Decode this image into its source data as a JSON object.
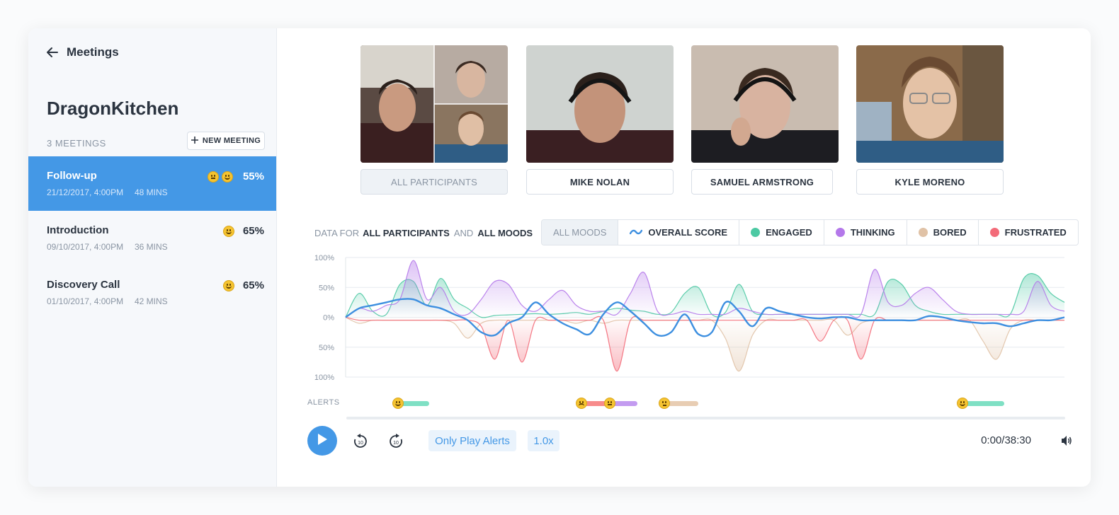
{
  "sidebar": {
    "back_label": "Meetings",
    "project_title": "DragonKitchen",
    "meetings_count": "3 MEETINGS",
    "new_meeting_label": "NEW MEETING",
    "meetings": [
      {
        "title": "Follow-up",
        "date": "21/12/2017, 4:00PM",
        "duration": "48 MINS",
        "score": "55%",
        "emojis": [
          "thinking-face-emoji",
          "smiley-face-emoji"
        ]
      },
      {
        "title": "Introduction",
        "date": "09/10/2017, 4:00PM",
        "duration": "36 MINS",
        "score": "65%",
        "emojis": [
          "smiley-face-emoji"
        ]
      },
      {
        "title": "Discovery Call",
        "date": "01/10/2017, 4:00PM",
        "duration": "42 MINS",
        "score": "65%",
        "emojis": [
          "smiley-face-emoji"
        ]
      }
    ]
  },
  "participants": [
    {
      "name": "ALL PARTICIPANTS",
      "selected": true
    },
    {
      "name": "MIKE NOLAN"
    },
    {
      "name": "SAMUEL ARMSTRONG"
    },
    {
      "name": "KYLE MORENO"
    }
  ],
  "filter": {
    "prefix": "DATA FOR",
    "participants": "ALL PARTICIPANTS",
    "joiner": "AND",
    "moods": "ALL MOODS"
  },
  "mood_tabs": [
    {
      "label": "ALL MOODS",
      "active": true
    },
    {
      "label": "OVERALL SCORE",
      "icon": "wave-icon",
      "color": "#3d8fe0"
    },
    {
      "label": "ENGAGED",
      "color": "#4cc9a3"
    },
    {
      "label": "THINKING",
      "color": "#b478ea"
    },
    {
      "label": "BORED",
      "color": "#e0c2a6"
    },
    {
      "label": "FRUSTRATED",
      "color": "#f36b79"
    }
  ],
  "chart_data": {
    "type": "area",
    "y_tick_labels": [
      "100%",
      "50%",
      "0%",
      "50%",
      "100%"
    ],
    "ylim": [
      -100,
      100
    ],
    "x_count": 54,
    "grid": true,
    "series": [
      {
        "name": "ENGAGED",
        "color": "#4cc9a3",
        "values": [
          0,
          40,
          10,
          5,
          55,
          60,
          20,
          65,
          30,
          15,
          0,
          3,
          4,
          5,
          6,
          5,
          6,
          8,
          5,
          10,
          15,
          12,
          10,
          5,
          8,
          40,
          50,
          5,
          8,
          55,
          10,
          5,
          5,
          5,
          5,
          5,
          5,
          5,
          5,
          5,
          60,
          55,
          20,
          10,
          5,
          5,
          5,
          5,
          5,
          5,
          65,
          70,
          40,
          25
        ]
      },
      {
        "name": "THINKING",
        "color": "#b478ea",
        "values": [
          0,
          15,
          10,
          20,
          30,
          95,
          30,
          50,
          10,
          5,
          30,
          60,
          55,
          20,
          10,
          30,
          45,
          20,
          10,
          10,
          5,
          40,
          75,
          10,
          5,
          10,
          5,
          5,
          5,
          15,
          10,
          5,
          5,
          5,
          5,
          5,
          5,
          5,
          5,
          80,
          25,
          20,
          40,
          50,
          30,
          10,
          5,
          5,
          5,
          5,
          10,
          60,
          20,
          10
        ]
      },
      {
        "name": "BORED",
        "color": "#e0c2a6",
        "values": [
          0,
          -10,
          -5,
          -5,
          -5,
          -5,
          -5,
          -5,
          -10,
          -35,
          -10,
          -5,
          -5,
          -5,
          -5,
          -5,
          -5,
          -10,
          -5,
          -10,
          -5,
          -5,
          -5,
          -5,
          -5,
          -5,
          -5,
          -5,
          -35,
          -90,
          -30,
          -5,
          -5,
          -5,
          -5,
          -5,
          -5,
          -30,
          -10,
          -5,
          -5,
          -5,
          -5,
          -5,
          -5,
          -5,
          -5,
          -40,
          -70,
          -20,
          -5,
          -5,
          -5,
          -5
        ]
      },
      {
        "name": "FRUSTRATED",
        "color": "#f36b79",
        "values": [
          0,
          -5,
          -5,
          -5,
          -5,
          -5,
          -5,
          -5,
          -5,
          -5,
          -15,
          -70,
          -5,
          -75,
          -5,
          -5,
          -5,
          -5,
          -5,
          -5,
          -90,
          -5,
          -5,
          -5,
          -5,
          -5,
          -5,
          -5,
          -5,
          -5,
          -5,
          -5,
          -5,
          -5,
          -5,
          -40,
          -5,
          -5,
          -70,
          -5,
          -5,
          -5,
          -5,
          -5,
          -5,
          -5,
          -5,
          -5,
          -5,
          -5,
          -5,
          -5,
          -5,
          -5
        ]
      },
      {
        "name": "OVERALL SCORE",
        "color": "#3d8fe0",
        "values": [
          0,
          15,
          20,
          25,
          30,
          30,
          20,
          15,
          5,
          -5,
          -25,
          -30,
          -10,
          0,
          25,
          5,
          -10,
          -20,
          -28,
          5,
          25,
          10,
          -10,
          -30,
          -25,
          5,
          -28,
          -25,
          25,
          10,
          -15,
          15,
          10,
          5,
          0,
          -2,
          0,
          0,
          -5,
          -5,
          -5,
          -5,
          -5,
          2,
          0,
          -5,
          -8,
          -10,
          -10,
          -15,
          -10,
          -5,
          -5,
          0
        ]
      }
    ]
  },
  "alerts": {
    "label": "ALERTS",
    "items": [
      {
        "emoji": "smiley-face-emoji",
        "color": "#7fe0c4",
        "start": 0.07,
        "end": 0.115
      },
      {
        "emoji": "frustrated-face-emoji",
        "color": "#f78b8b",
        "start": 0.325,
        "end": 0.365
      },
      {
        "emoji": "thinking-face-emoji",
        "color": "#c39bf0",
        "start": 0.365,
        "end": 0.405
      },
      {
        "emoji": "sleepy-face-emoji",
        "color": "#e8cdb3",
        "start": 0.44,
        "end": 0.49
      },
      {
        "emoji": "smiley-face-emoji",
        "color": "#7fe0c4",
        "start": 0.855,
        "end": 0.915
      }
    ]
  },
  "player": {
    "only_play_alerts_label": "Only Play Alerts",
    "speed_label": "1.0x",
    "time": "0:00/38:30",
    "skip_back_seconds": "10",
    "skip_forward_seconds": "10"
  }
}
